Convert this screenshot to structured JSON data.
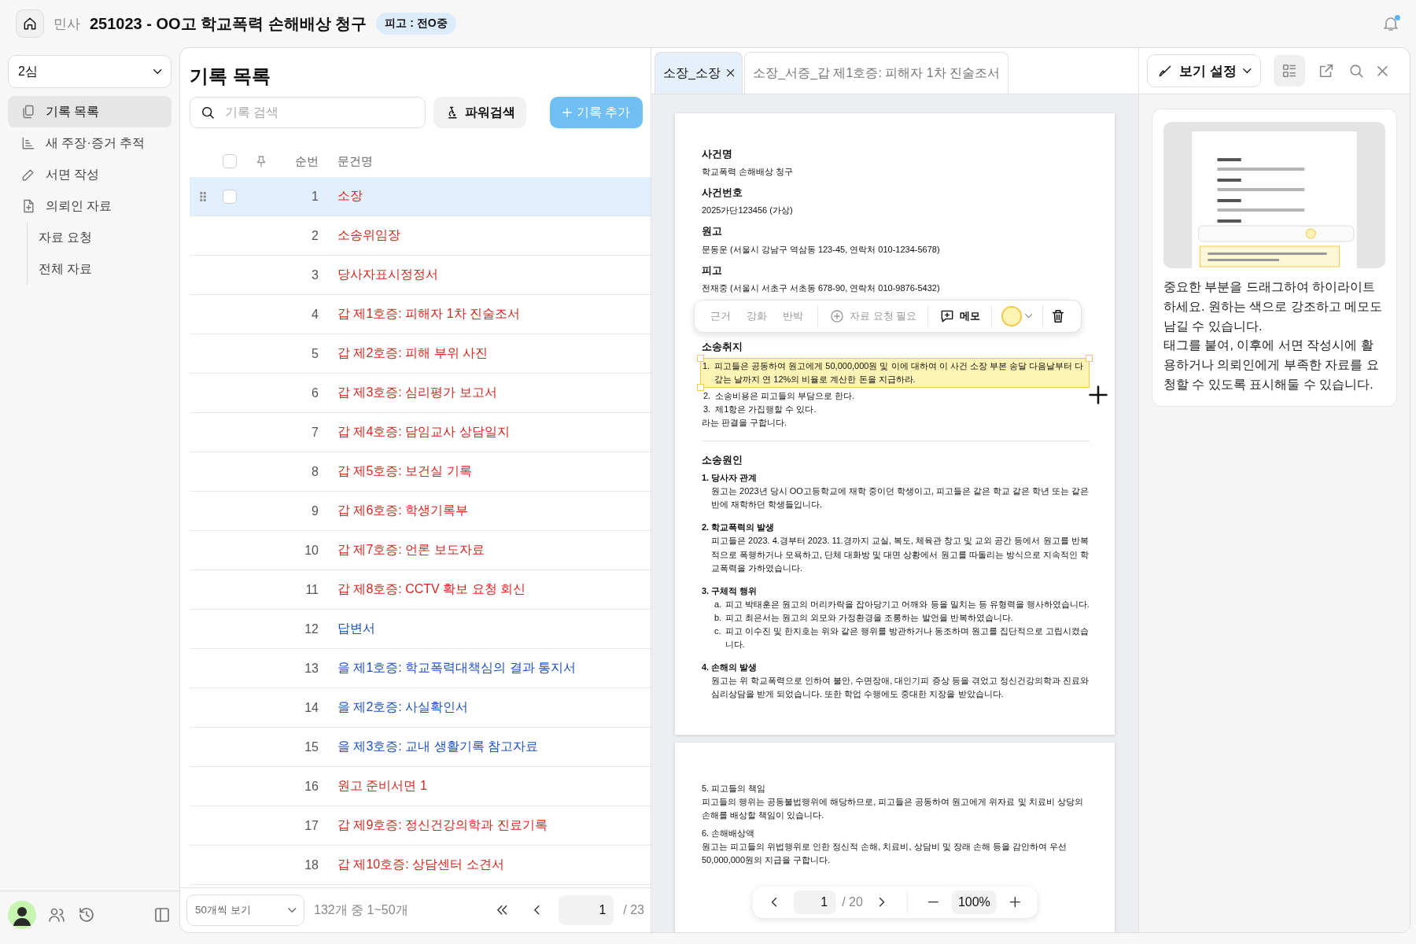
{
  "header": {
    "category": "민사",
    "title": "251023 - OO고 학교폭력 손해배상 청구",
    "badge": "피고 : 전O중"
  },
  "sidebar": {
    "instance": "2심",
    "items": [
      {
        "label": "기록 목록",
        "selected": true
      },
      {
        "label": "새 주장·증거 추적",
        "selected": false
      },
      {
        "label": "서면 작성",
        "selected": false
      },
      {
        "label": "의뢰인 자료",
        "selected": false,
        "children": [
          {
            "label": "자료 요청",
            "selected": false
          },
          {
            "label": "전체 자료",
            "selected": false
          }
        ]
      }
    ]
  },
  "records": {
    "title": "기록 목록",
    "search": {
      "placeholder": "기록 검색"
    },
    "power_search": "파워검색",
    "add_button": "기록 추가",
    "all_checked": false,
    "columns": [
      "순번",
      "문건명"
    ],
    "rows": [
      {
        "no": "1",
        "title": "소장",
        "color": "#d7261e",
        "selected": true,
        "checked": false
      },
      {
        "no": "2",
        "title": "소송위임장",
        "color": "#d7261e",
        "selected": false,
        "checked": false
      },
      {
        "no": "3",
        "title": "당사자표시정정서",
        "color": "#d7261e",
        "selected": false,
        "checked": false
      },
      {
        "no": "4",
        "title": "갑 제1호증: 피해자 1차 진술조서",
        "color": "#d7261e",
        "selected": false,
        "checked": false
      },
      {
        "no": "5",
        "title": "갑 제2호증: 피해 부위 사진",
        "color": "#d7261e",
        "selected": false,
        "checked": false
      },
      {
        "no": "6",
        "title": "갑 제3호증: 심리평가 보고서",
        "color": "#d7261e",
        "selected": false,
        "checked": false
      },
      {
        "no": "7",
        "title": "갑 제4호증: 담임교사 상담일지",
        "color": "#d7261e",
        "selected": false,
        "checked": false
      },
      {
        "no": "8",
        "title": "갑 제5호증: 보건실 기록",
        "color": "#d7261e",
        "selected": false,
        "checked": false
      },
      {
        "no": "9",
        "title": "갑 제6호증: 학생기록부",
        "color": "#d7261e",
        "selected": false,
        "checked": false
      },
      {
        "no": "10",
        "title": "갑 제7호증: 언론 보도자료",
        "color": "#d7261e",
        "selected": false,
        "checked": false
      },
      {
        "no": "11",
        "title": "갑 제8호증: CCTV 확보 요청 회신",
        "color": "#d7261e",
        "selected": false,
        "checked": false
      },
      {
        "no": "12",
        "title": "답변서",
        "color": "#1d4fc4",
        "selected": false,
        "checked": false
      },
      {
        "no": "13",
        "title": "을 제1호증: 학교폭력대책심의 결과 통지서",
        "color": "#1d4fc4",
        "selected": false,
        "checked": false
      },
      {
        "no": "14",
        "title": "을 제2호증: 사실확인서",
        "color": "#1d4fc4",
        "selected": false,
        "checked": false
      },
      {
        "no": "15",
        "title": "을 제3호증: 교내 생활기록 참고자료",
        "color": "#1d4fc4",
        "selected": false,
        "checked": false
      },
      {
        "no": "16",
        "title": "원고 준비서면 1",
        "color": "#d7261e",
        "selected": false,
        "checked": false
      },
      {
        "no": "17",
        "title": "갑 제9호증: 정신건강의학과 진료기록",
        "color": "#d7261e",
        "selected": false,
        "checked": false
      },
      {
        "no": "18",
        "title": "갑 제10호증: 상담센터 소견서",
        "color": "#d7261e",
        "selected": false,
        "checked": false
      }
    ],
    "footer": {
      "page_size": "50개씩 보기",
      "range": "132개 중 1~50개",
      "page": "1",
      "total": "/ 23"
    }
  },
  "viewer": {
    "tabs": [
      {
        "label": "소장_소장",
        "selected": true
      },
      {
        "label": "소장_서증_갑 제1호증: 피해자 1차 진술조서",
        "selected": false
      }
    ],
    "highlight_toolbar": {
      "tags": [
        {
          "label": "근거",
          "selected": false
        },
        {
          "label": "강화",
          "selected": false
        },
        {
          "label": "반박",
          "selected": false
        }
      ],
      "request": "자료 요청 필요",
      "memo": "메모",
      "color": "#fdf3b5"
    },
    "pages": [
      {
        "blocks": [
          {
            "kind": "label",
            "text": "사건명"
          },
          {
            "kind": "text",
            "text": "학교폭력 손해배상 청구"
          },
          {
            "kind": "label",
            "text": "사건번호"
          },
          {
            "kind": "text",
            "text": "2025가단123456 (가상)"
          },
          {
            "kind": "label",
            "text": "원고"
          },
          {
            "kind": "text",
            "text": "문동운 (서울시 강남구 역삼동 123-45, 연락처 010-1234-5678)"
          },
          {
            "kind": "label",
            "text": "피고"
          },
          {
            "kind": "text",
            "text": "전재중 (서울시 서초구 서초동 678-90, 연락처 010-9876-5432)"
          },
          {
            "kind": "toolbar"
          },
          {
            "kind": "label",
            "text": "소송취지"
          },
          {
            "kind": "list",
            "items": [
              {
                "marker": "1.",
                "text": "피고들은 공동하여 원고에게 50,000,000원 및 이에 대하여 이 사건 소장 부본 송달 다음날부터 다 갚는 날까지 연 12%의 비율로 계산한 돈을 지급하라.",
                "highlighted": true
              },
              {
                "marker": "2.",
                "text": "소송비용은 피고들의 부담으로 한다.",
                "highlighted": false
              },
              {
                "marker": "3.",
                "text": "제1항은 가집행할 수 있다.",
                "highlighted": false
              }
            ]
          },
          {
            "kind": "text",
            "text": "라는 판결을 구합니다."
          },
          {
            "kind": "divider"
          },
          {
            "kind": "label",
            "text": "소송원인"
          },
          {
            "kind": "item",
            "title": "1. 당사자 관계",
            "body": "원고는 2023년 당시 OO고등학교에 재학 중이던 학생이고, 피고들은 같은 학교 같은 학년 또는 같은 반에 재학하던 학생들입니다."
          },
          {
            "kind": "item",
            "title": "2. 학교폭력의 발생",
            "body": "피고들은 2023. 4.경부터 2023. 11.경까지 교실, 복도, 체육관 창고 및 교외 공간 등에서 원고를 반복적으로 폭행하거나 모욕하고, 단체 대화방 및 대면 상황에서 원고를 따돌리는 방식으로 지속적인 학교폭력을 가하였습니다."
          },
          {
            "kind": "item",
            "title": "3. 구체적 행위",
            "subitems": [
              {
                "marker": "a.",
                "text": "피고 박태훈은 원고의 머리카락을 잡아당기고 어깨와 등을 밀치는 등 유형력을 행사하였습니다."
              },
              {
                "marker": "b.",
                "text": "피고 최은서는 원고의 외모와 가정환경을 조롱하는 발언을 반복하였습니다."
              },
              {
                "marker": "c.",
                "text": "피고 이수진 및 한지호는 위와 같은 행위를 방관하거나 동조하며 원고를 집단적으로 고립시켰습니다."
              }
            ]
          },
          {
            "kind": "item",
            "title": "4. 손해의 발생",
            "body": "원고는 위 학교폭력으로 인하여 불안, 수면장애, 대인기피 증상 등을 겪었고 정신건강의학과 진료와 심리상담을 받게 되었습니다. 또한 학업 수행에도 중대한 지장을 받았습니다."
          }
        ]
      },
      {
        "blocks": [
          {
            "kind": "plain_title",
            "text": "5. 피고들의 책임"
          },
          {
            "kind": "text",
            "text": "피고들의 행위는 공동불법행위에 해당하므로, 피고들은 공동하여 원고에게 위자료 및 치료비 상당의 손해를 배상할 책임이 있습니다."
          },
          {
            "kind": "plain_title",
            "text": "6. 손해배상액"
          },
          {
            "kind": "text",
            "text": "원고는 피고들의 위법행위로 인한 정신적 손해, 치료비, 상담비 및 장래 손해 등을 감안하여 우선 50,000,000원의 지급을 구합니다."
          }
        ]
      }
    ],
    "pager": {
      "page": "1",
      "total": "/ 20",
      "zoom": "100%"
    }
  },
  "guide": {
    "view_settings": "보기 설정",
    "paragraphs": [
      "중요한 부분을 드래그하여 하이라이트 하세요. 원하는 색으로 강조하고 메모도 남길 수 있습니다.",
      "태그를 붙여, 이후에 서면 작성시에 활용하거나 의뢰인에게 부족한 자료를 요청할 수 있도록 표시해둘 수 있습니다."
    ]
  }
}
